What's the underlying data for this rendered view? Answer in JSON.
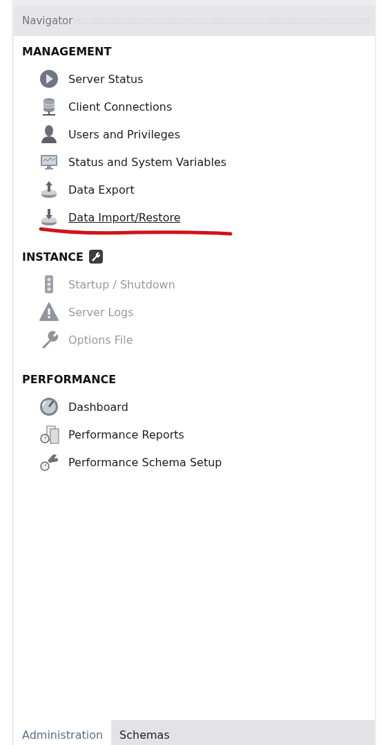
{
  "panel": {
    "title": "Navigator"
  },
  "sections": [
    {
      "title": "MANAGEMENT",
      "has_tool_icon": false,
      "items": [
        {
          "label": "Server Status",
          "disabled": false,
          "underlined": false,
          "annotated": false
        },
        {
          "label": "Client Connections",
          "disabled": false,
          "underlined": false,
          "annotated": false
        },
        {
          "label": "Users and Privileges",
          "disabled": false,
          "underlined": false,
          "annotated": false
        },
        {
          "label": "Status and System Variables",
          "disabled": false,
          "underlined": false,
          "annotated": false
        },
        {
          "label": "Data Export",
          "disabled": false,
          "underlined": false,
          "annotated": false
        },
        {
          "label": "Data Import/Restore",
          "disabled": false,
          "underlined": true,
          "annotated": true
        }
      ]
    },
    {
      "title": "INSTANCE",
      "has_tool_icon": true,
      "items": [
        {
          "label": "Startup / Shutdown",
          "disabled": true,
          "underlined": false,
          "annotated": false
        },
        {
          "label": "Server Logs",
          "disabled": true,
          "underlined": false,
          "annotated": false
        },
        {
          "label": "Options File",
          "disabled": true,
          "underlined": false,
          "annotated": false
        }
      ]
    },
    {
      "title": "PERFORMANCE",
      "has_tool_icon": false,
      "items": [
        {
          "label": "Dashboard",
          "disabled": false,
          "underlined": false,
          "annotated": false
        },
        {
          "label": "Performance Reports",
          "disabled": false,
          "underlined": false,
          "annotated": false
        },
        {
          "label": "Performance Schema Setup",
          "disabled": false,
          "underlined": false,
          "annotated": false
        }
      ]
    }
  ],
  "tabs": [
    {
      "label": "Administration",
      "selected": true
    },
    {
      "label": "Schemas",
      "selected": false
    }
  ]
}
